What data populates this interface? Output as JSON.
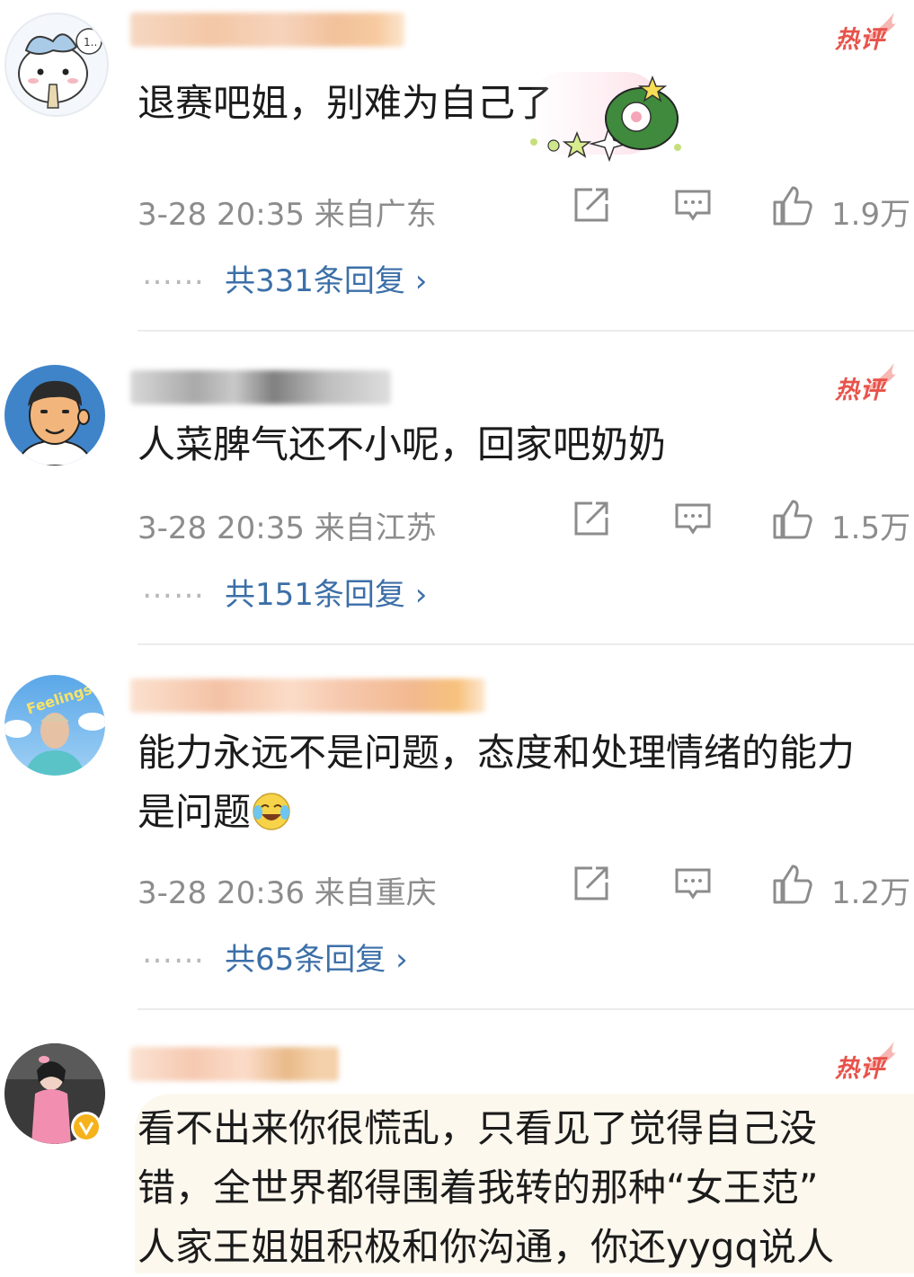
{
  "hot_badge_label": "热评",
  "accent_color": "#3c6fa8",
  "hot_color": "#e8524a",
  "comments": [
    {
      "text": "退赛吧姐，别难为自己了",
      "time": "3-28 20:35",
      "location": "来自广东",
      "likes": "1.9万",
      "replies_label": "共331条回复",
      "avatar_icon": "cartoon-character-avatar"
    },
    {
      "text": "人菜脾气还不小呢，回家吧奶奶",
      "time": "3-28 20:35",
      "location": "来自江苏",
      "likes": "1.5万",
      "replies_label": "共151条回复",
      "avatar_icon": "cartoon-man-avatar"
    },
    {
      "text_line1": "能力永远不是问题，态度和处理情绪的能力",
      "text_line2": "是问题",
      "time": "3-28 20:36",
      "location": "来自重庆",
      "likes": "1.2万",
      "replies_label": "共65条回复",
      "avatar_icon": "feelings-photo-avatar",
      "emoji_icon": "laughing-crying-emoji"
    },
    {
      "text_line1": "看不出来你很慌乱，只看见了觉得自己没",
      "text_line2": "错，全世界都得围着我转的那种“女王范”",
      "text_line3": "人家王姐姐积极和你沟通，你还yygq说人",
      "avatar_icon": "girl-photo-avatar",
      "verified_icon": "verified-badge-icon"
    }
  ],
  "reply_dots": "……",
  "reply_chevron": "›"
}
